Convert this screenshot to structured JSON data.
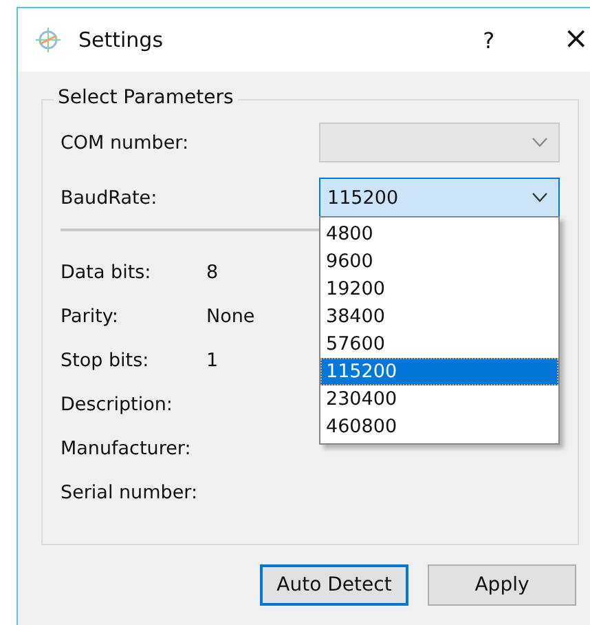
{
  "window": {
    "title": "Settings",
    "help": "?",
    "close": "×"
  },
  "group": {
    "title": "Select Parameters",
    "combos": [
      {
        "label": "COM number:",
        "disabled": true,
        "open": false
      },
      {
        "label": "BaudRate:",
        "value": "115200",
        "disabled": false,
        "open": true
      }
    ],
    "options": [
      {
        "label": "4800",
        "selected": false
      },
      {
        "label": "9600",
        "selected": false
      },
      {
        "label": "19200",
        "selected": false
      },
      {
        "label": "38400",
        "selected": false
      },
      {
        "label": "57600",
        "selected": false
      },
      {
        "label": "115200",
        "selected": true
      },
      {
        "label": "230400",
        "selected": false
      },
      {
        "label": "460800",
        "selected": false
      }
    ],
    "info": [
      {
        "label": "Data bits:",
        "value": "8"
      },
      {
        "label": "Parity:",
        "value": "None"
      },
      {
        "label": "Stop bits:",
        "value": "1"
      },
      {
        "label": "Description:"
      },
      {
        "label": "Manufacturer:"
      },
      {
        "label": "Serial number:"
      }
    ]
  },
  "buttons": [
    {
      "label": "Auto Detect",
      "default": true
    },
    {
      "label": "Apply",
      "default": false
    }
  ]
}
